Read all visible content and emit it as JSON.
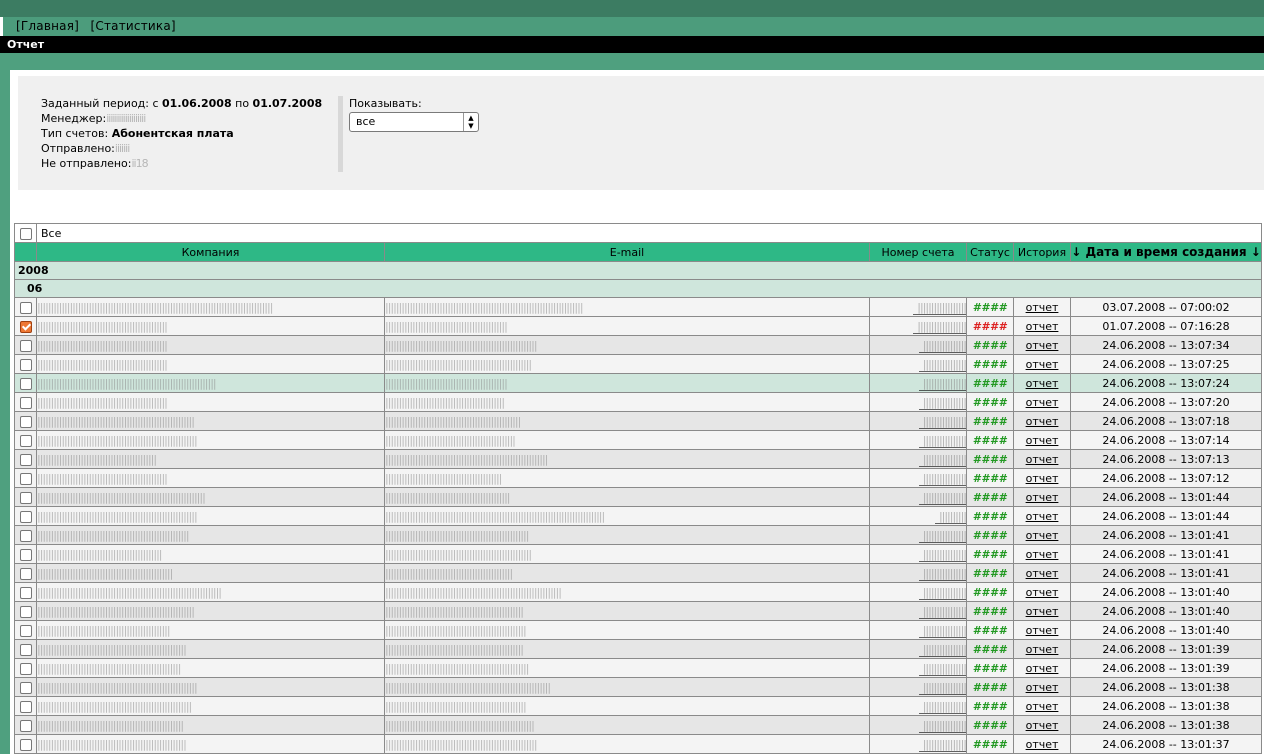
{
  "nav": {
    "home": "[Главная]",
    "stats": "[Статистика]"
  },
  "page_title": "Отчет",
  "info": {
    "period_label": "Заданный период: с",
    "period_from": "01.06.2008",
    "period_mid": "по",
    "period_to": "01.07.2008",
    "manager_label": "Менеджер:",
    "manager_value": "iiiiiiiiiiiiiiiiiii",
    "type_label": "Тип счетов:",
    "type_value": "Абонентская плата",
    "sent_label": "Отправлено:",
    "sent_value": "iiiiiii",
    "notsent_label": "Не отправлено:",
    "notsent_value": "ii18"
  },
  "filter": {
    "label": "Показывать:",
    "value": "все"
  },
  "table": {
    "select_all_label": "Все",
    "headers": {
      "company": "Компания",
      "email": "E-mail",
      "number": "Номер счета",
      "status": "Статус",
      "history": "История",
      "date": "↓ Дата и время создания ↓"
    },
    "year": "2008",
    "month": "06",
    "status_text": "####",
    "history_text": "отчет",
    "rows": [
      {
        "company": "|||||||||||||||||||||||||||||||||||||||||||||||||||||||||||||||||||||||||||||||||||||||",
        "email": "|||||||||||||||||||||||||||||||||||||||||||||||||||||||||||||||||||||||||",
        "number": "||||||||||||||||||",
        "status": "ok",
        "date": "03.07.2008 -- 07:00:02",
        "checked": false,
        "style": ""
      },
      {
        "company": "||||||||||||||||||||||||||||||||||||||||||||||||",
        "email": "|||||||||||||||||||||||||||||||||||||||||||||",
        "number": "||||||||||||||||||",
        "status": "bad",
        "date": "01.07.2008 -- 07:16:28",
        "checked": true,
        "style": ""
      },
      {
        "company": "||||||||||||||||||||||||||||||||||||||||||||||||",
        "email": "||||||||||||||||||||||||||||||||||||||||||||||||||||||||",
        "number": "||||||||||||||||",
        "status": "ok",
        "date": "24.06.2008 -- 13:07:34",
        "checked": false,
        "style": "alt"
      },
      {
        "company": "||||||||||||||||||||||||||||||||||||||||||||||||",
        "email": "||||||||||||||||||||||||||||||||||||||||||||||||||||||",
        "number": "||||||||||||||||",
        "status": "ok",
        "date": "24.06.2008 -- 13:07:25",
        "checked": false,
        "style": ""
      },
      {
        "company": "||||||||||||||||||||||||||||||||||||||||||||||||||||||||||||||||||",
        "email": "|||||||||||||||||||||||||||||||||||||||||||||",
        "number": "||||||||||||||||",
        "status": "ok",
        "date": "24.06.2008 -- 13:07:24",
        "checked": false,
        "style": "hl"
      },
      {
        "company": "||||||||||||||||||||||||||||||||||||||||||||||||",
        "email": "||||||||||||||||||||||||||||||||||||||||||||",
        "number": "||||||||||||||||",
        "status": "ok",
        "date": "24.06.2008 -- 13:07:20",
        "checked": false,
        "style": ""
      },
      {
        "company": "||||||||||||||||||||||||||||||||||||||||||||||||||||||||||",
        "email": "||||||||||||||||||||||||||||||||||||||||||||||||||",
        "number": "||||||||||||||||",
        "status": "ok",
        "date": "24.06.2008 -- 13:07:18",
        "checked": false,
        "style": "alt"
      },
      {
        "company": "|||||||||||||||||||||||||||||||||||||||||||||||||||||||||||",
        "email": "||||||||||||||||||||||||||||||||||||||||||||||||",
        "number": "||||||||||||||||",
        "status": "ok",
        "date": "24.06.2008 -- 13:07:14",
        "checked": false,
        "style": ""
      },
      {
        "company": "||||||||||||||||||||||||||||||||||||||||||||",
        "email": "||||||||||||||||||||||||||||||||||||||||||||||||||||||||||||",
        "number": "||||||||||||||||",
        "status": "ok",
        "date": "24.06.2008 -- 13:07:13",
        "checked": false,
        "style": "alt"
      },
      {
        "company": "||||||||||||||||||||||||||||||||||||||||||||||||",
        "email": "|||||||||||||||||||||||||||||||||||||||||||",
        "number": "||||||||||||||||",
        "status": "ok",
        "date": "24.06.2008 -- 13:07:12",
        "checked": false,
        "style": ""
      },
      {
        "company": "||||||||||||||||||||||||||||||||||||||||||||||||||||||||||||||",
        "email": "||||||||||||||||||||||||||||||||||||||||||||||",
        "number": "||||||||||||||||",
        "status": "ok",
        "date": "24.06.2008 -- 13:01:44",
        "checked": false,
        "style": "alt"
      },
      {
        "company": "|||||||||||||||||||||||||||||||||||||||||||||||||||||||||||",
        "email": "|||||||||||||||||||||||||||||||||||||||||||||||||||||||||||||||||||||||||||||||||",
        "number": "||||||||||",
        "status": "ok",
        "date": "24.06.2008 -- 13:01:44",
        "checked": false,
        "style": ""
      },
      {
        "company": "||||||||||||||||||||||||||||||||||||||||||||||||||||||||",
        "email": "|||||||||||||||||||||||||||||||||||||||||||||||||||||",
        "number": "||||||||||||||||",
        "status": "ok",
        "date": "24.06.2008 -- 13:01:41",
        "checked": false,
        "style": "alt"
      },
      {
        "company": "||||||||||||||||||||||||||||||||||||||||||||||",
        "email": "||||||||||||||||||||||||||||||||||||||||||||||||||||||",
        "number": "||||||||||||||||",
        "status": "ok",
        "date": "24.06.2008 -- 13:01:41",
        "checked": false,
        "style": ""
      },
      {
        "company": "||||||||||||||||||||||||||||||||||||||||||||||||||",
        "email": "|||||||||||||||||||||||||||||||||||||||||||||||",
        "number": "||||||||||||||||",
        "status": "ok",
        "date": "24.06.2008 -- 13:01:41",
        "checked": false,
        "style": "alt"
      },
      {
        "company": "||||||||||||||||||||||||||||||||||||||||||||||||||||||||||||||||||||",
        "email": "|||||||||||||||||||||||||||||||||||||||||||||||||||||||||||||||||",
        "number": "||||||||||||||||",
        "status": "ok",
        "date": "24.06.2008 -- 13:01:40",
        "checked": false,
        "style": ""
      },
      {
        "company": "||||||||||||||||||||||||||||||||||||||||||||||||||||||||||",
        "email": "|||||||||||||||||||||||||||||||||||||||||||||||||||",
        "number": "||||||||||||||||",
        "status": "ok",
        "date": "24.06.2008 -- 13:01:40",
        "checked": false,
        "style": "alt"
      },
      {
        "company": "|||||||||||||||||||||||||||||||||||||||||||||||||",
        "email": "||||||||||||||||||||||||||||||||||||||||||||||||||||",
        "number": "||||||||||||||||",
        "status": "ok",
        "date": "24.06.2008 -- 13:01:40",
        "checked": false,
        "style": ""
      },
      {
        "company": "|||||||||||||||||||||||||||||||||||||||||||||||||||||||",
        "email": "|||||||||||||||||||||||||||||||||||||||||||||||||||",
        "number": "||||||||||||||||",
        "status": "ok",
        "date": "24.06.2008 -- 13:01:39",
        "checked": false,
        "style": "alt"
      },
      {
        "company": "|||||||||||||||||||||||||||||||||||||||||||||||||||||",
        "email": "|||||||||||||||||||||||||||||||||||||||||||||||||||||",
        "number": "||||||||||||||||",
        "status": "ok",
        "date": "24.06.2008 -- 13:01:39",
        "checked": false,
        "style": ""
      },
      {
        "company": "|||||||||||||||||||||||||||||||||||||||||||||||||||||||||||",
        "email": "|||||||||||||||||||||||||||||||||||||||||||||||||||||||||||||",
        "number": "||||||||||||||||",
        "status": "ok",
        "date": "24.06.2008 -- 13:01:38",
        "checked": false,
        "style": "alt"
      },
      {
        "company": "|||||||||||||||||||||||||||||||||||||||||||||||||||||||||",
        "email": "||||||||||||||||||||||||||||||||||||||||||||||||||||",
        "number": "||||||||||||||||",
        "status": "ok",
        "date": "24.06.2008 -- 13:01:38",
        "checked": false,
        "style": ""
      },
      {
        "company": "||||||||||||||||||||||||||||||||||||||||||||||||||||||",
        "email": "|||||||||||||||||||||||||||||||||||||||||||||||||||||||",
        "number": "||||||||||||||||",
        "status": "ok",
        "date": "24.06.2008 -- 13:01:38",
        "checked": false,
        "style": "alt"
      },
      {
        "company": "|||||||||||||||||||||||||||||||||||||||||||||||||||||||",
        "email": "||||||||||||||||||||||||||||||||||||||||||||||||||||||||",
        "number": "||||||||||||||||",
        "status": "ok",
        "date": "24.06.2008 -- 13:01:37",
        "checked": false,
        "style": ""
      }
    ]
  },
  "colors": {
    "nav_green": "#4c9c7c",
    "header_green": "#2eb886",
    "group_bg": "#cfe6dc",
    "status_ok": "#229922",
    "status_bad": "#dd2222"
  }
}
